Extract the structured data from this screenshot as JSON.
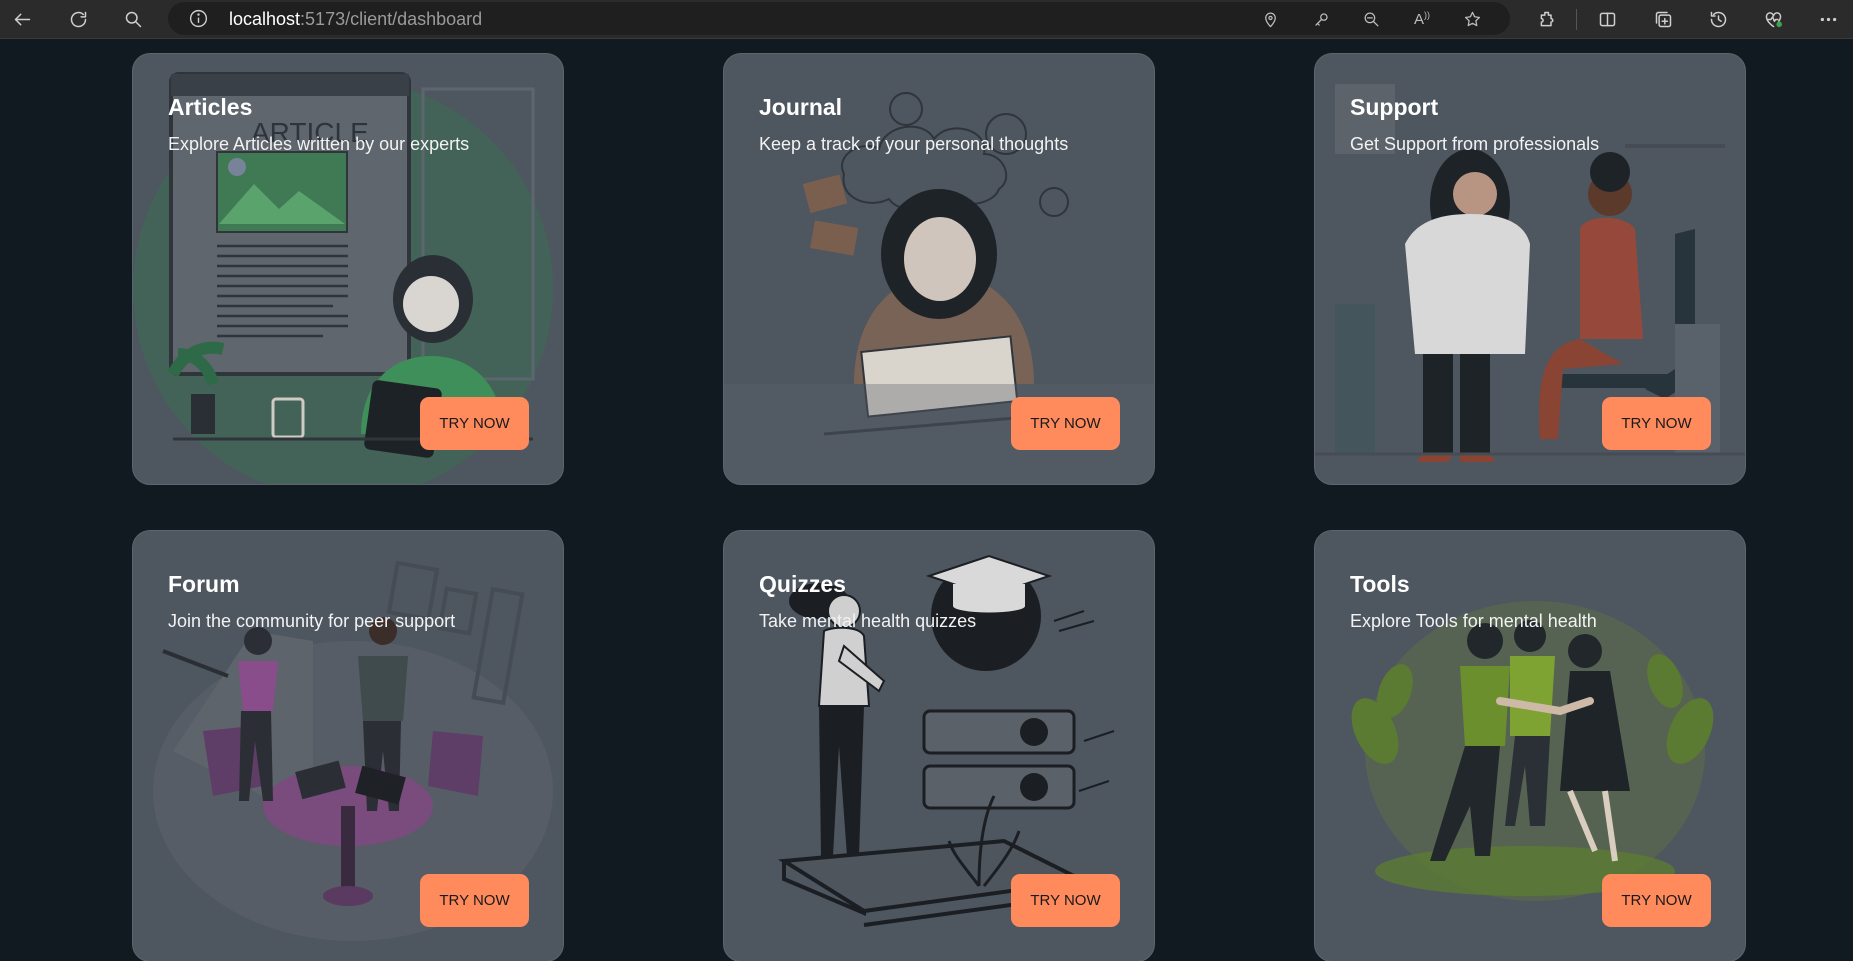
{
  "browser": {
    "url_host": "localhost",
    "url_path": ":5173/client/dashboard"
  },
  "cards": [
    {
      "title": "Articles",
      "description": "Explore Articles written by our experts",
      "button": "TRY NOW",
      "illustration_text": "ARTICLE"
    },
    {
      "title": "Journal",
      "description": "Keep a track of your personal thoughts",
      "button": "TRY NOW"
    },
    {
      "title": "Support",
      "description": "Get Support from professionals",
      "button": "TRY NOW"
    },
    {
      "title": "Forum",
      "description": "Join the community for peer support",
      "button": "TRY NOW"
    },
    {
      "title": "Quizzes",
      "description": "Take mental health quizzes",
      "button": "TRY NOW"
    },
    {
      "title": "Tools",
      "description": "Explore Tools for mental health",
      "button": "TRY NOW"
    }
  ],
  "colors": {
    "background": "#111a21",
    "card": "#4e5660",
    "button": "#ff8a5c"
  }
}
